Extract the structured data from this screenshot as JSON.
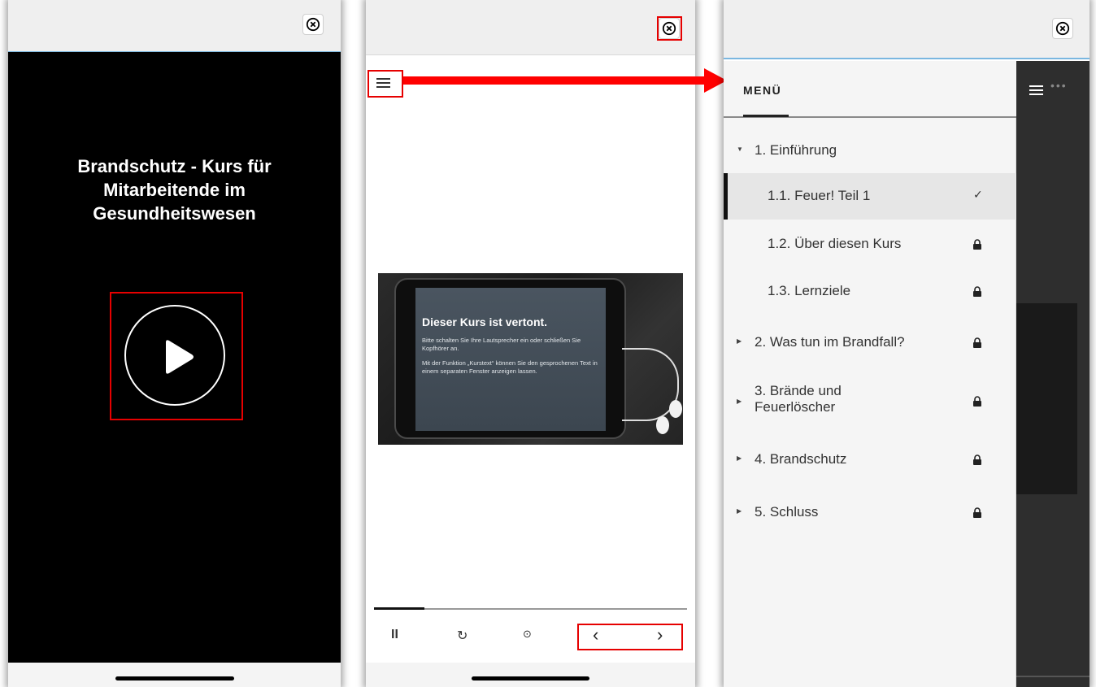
{
  "screen1": {
    "course_title": "Brandschutz - Kurs für Mitarbeitende im Gesundheitswesen"
  },
  "screen2": {
    "slide_heading": "Dieser Kurs ist vertont.",
    "slide_text_1": "Bitte schalten Sie Ihre Lautsprecher ein oder schließen Sie Kopfhörer an.",
    "slide_text_2": "Mit der Funktion „Kurstext“ können Sie den gesprochenen Text in einem separaten Fenster anzeigen lassen.",
    "audio_progress": 0.16,
    "controls": {
      "pause": "II",
      "replay": "↻",
      "prev": "‹",
      "next": "›"
    }
  },
  "screen3": {
    "menu_title": "MENÜ",
    "items": [
      {
        "label": "1. Einführung",
        "type": "chapter",
        "expanded": true,
        "locked": false
      },
      {
        "label": "1.1. Feuer! Teil 1",
        "type": "lesson",
        "active": true,
        "status": "completed"
      },
      {
        "label": "1.2. Über diesen Kurs",
        "type": "lesson",
        "locked": true
      },
      {
        "label": "1.3. Lernziele",
        "type": "lesson",
        "locked": true
      },
      {
        "label": "2. Was tun im Brandfall?",
        "type": "chapter",
        "locked": true
      },
      {
        "label": "3. Brände und Feuerlöscher",
        "type": "chapter",
        "locked": true
      },
      {
        "label": "4. Brandschutz",
        "type": "chapter",
        "locked": true
      },
      {
        "label": "5. Schluss",
        "type": "chapter",
        "locked": true
      }
    ]
  },
  "colors": {
    "highlight": "#e60000",
    "top_border": "#7ab7e0"
  }
}
